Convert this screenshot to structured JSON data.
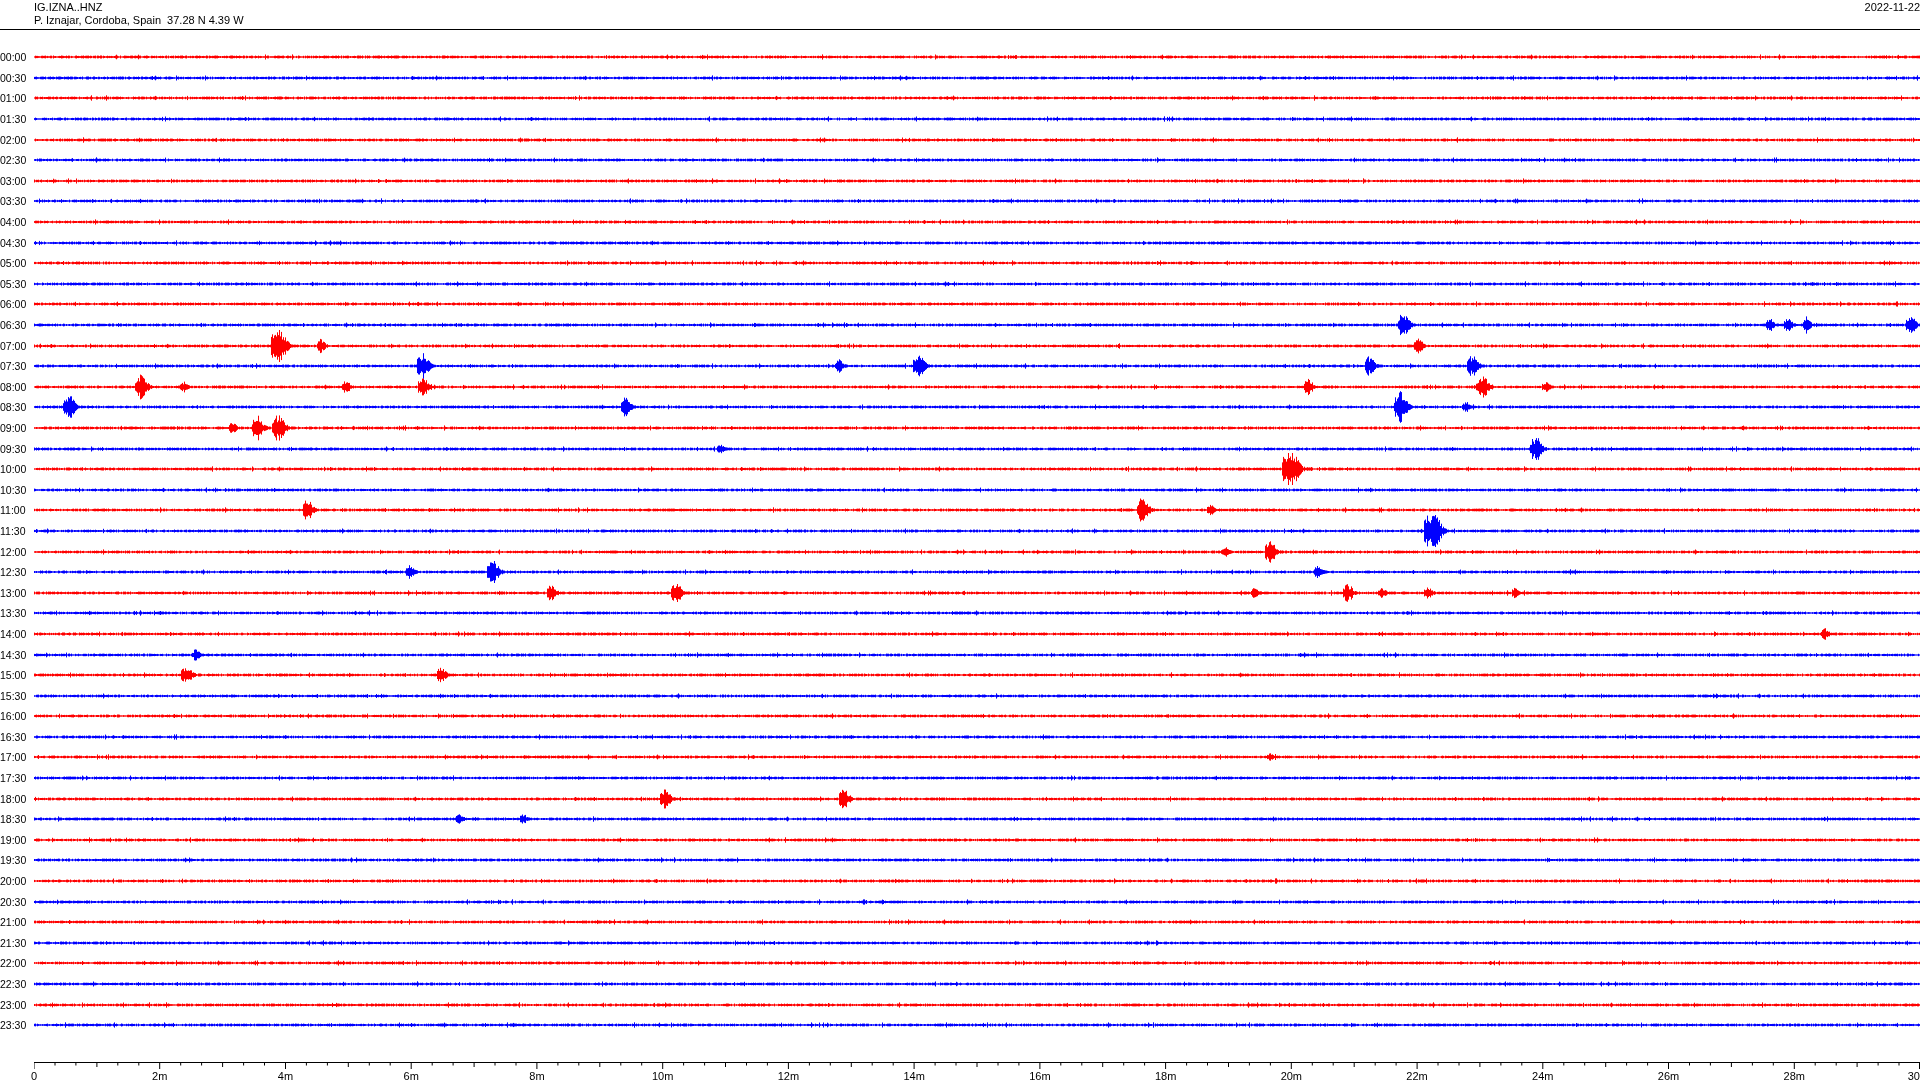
{
  "header": {
    "station_code": "IG.IZNA..HNZ",
    "location": "P. Iznajar, Cordoba, Spain  37.28 N 4.39 W",
    "date": "2022-11-22"
  },
  "rows": [
    {
      "time": "00:00",
      "color": "#ff0000"
    },
    {
      "time": "00:30",
      "color": "#0000ff"
    },
    {
      "time": "01:00",
      "color": "#ff0000"
    },
    {
      "time": "01:30",
      "color": "#0000ff"
    },
    {
      "time": "02:00",
      "color": "#ff0000"
    },
    {
      "time": "02:30",
      "color": "#0000ff"
    },
    {
      "time": "03:00",
      "color": "#ff0000"
    },
    {
      "time": "03:30",
      "color": "#0000ff"
    },
    {
      "time": "04:00",
      "color": "#ff0000"
    },
    {
      "time": "04:30",
      "color": "#0000ff"
    },
    {
      "time": "05:00",
      "color": "#ff0000"
    },
    {
      "time": "05:30",
      "color": "#0000ff"
    },
    {
      "time": "06:00",
      "color": "#ff0000"
    },
    {
      "time": "06:30",
      "color": "#0000ff"
    },
    {
      "time": "07:00",
      "color": "#ff0000"
    },
    {
      "time": "07:30",
      "color": "#0000ff"
    },
    {
      "time": "08:00",
      "color": "#ff0000"
    },
    {
      "time": "08:30",
      "color": "#0000ff"
    },
    {
      "time": "09:00",
      "color": "#ff0000"
    },
    {
      "time": "09:30",
      "color": "#0000ff"
    },
    {
      "time": "10:00",
      "color": "#ff0000"
    },
    {
      "time": "10:30",
      "color": "#0000ff"
    },
    {
      "time": "11:00",
      "color": "#ff0000"
    },
    {
      "time": "11:30",
      "color": "#0000ff"
    },
    {
      "time": "12:00",
      "color": "#ff0000"
    },
    {
      "time": "12:30",
      "color": "#0000ff"
    },
    {
      "time": "13:00",
      "color": "#ff0000"
    },
    {
      "time": "13:30",
      "color": "#0000ff"
    },
    {
      "time": "14:00",
      "color": "#ff0000"
    },
    {
      "time": "14:30",
      "color": "#0000ff"
    },
    {
      "time": "15:00",
      "color": "#ff0000"
    },
    {
      "time": "15:30",
      "color": "#0000ff"
    },
    {
      "time": "16:00",
      "color": "#ff0000"
    },
    {
      "time": "16:30",
      "color": "#0000ff"
    },
    {
      "time": "17:00",
      "color": "#ff0000"
    },
    {
      "time": "17:30",
      "color": "#0000ff"
    },
    {
      "time": "18:00",
      "color": "#ff0000"
    },
    {
      "time": "18:30",
      "color": "#0000ff"
    },
    {
      "time": "19:00",
      "color": "#ff0000"
    },
    {
      "time": "19:30",
      "color": "#0000ff"
    },
    {
      "time": "20:00",
      "color": "#ff0000"
    },
    {
      "time": "20:30",
      "color": "#0000ff"
    },
    {
      "time": "21:00",
      "color": "#ff0000"
    },
    {
      "time": "21:30",
      "color": "#0000ff"
    },
    {
      "time": "22:00",
      "color": "#ff0000"
    },
    {
      "time": "22:30",
      "color": "#0000ff"
    },
    {
      "time": "23:00",
      "color": "#ff0000"
    },
    {
      "time": "23:30",
      "color": "#0000ff"
    }
  ],
  "time_axis": {
    "labels": [
      "0",
      "2m",
      "4m",
      "6m",
      "8m",
      "10m",
      "12m",
      "14m",
      "16m",
      "18m",
      "20m",
      "22m",
      "24m",
      "26m",
      "28m",
      "30"
    ]
  }
}
